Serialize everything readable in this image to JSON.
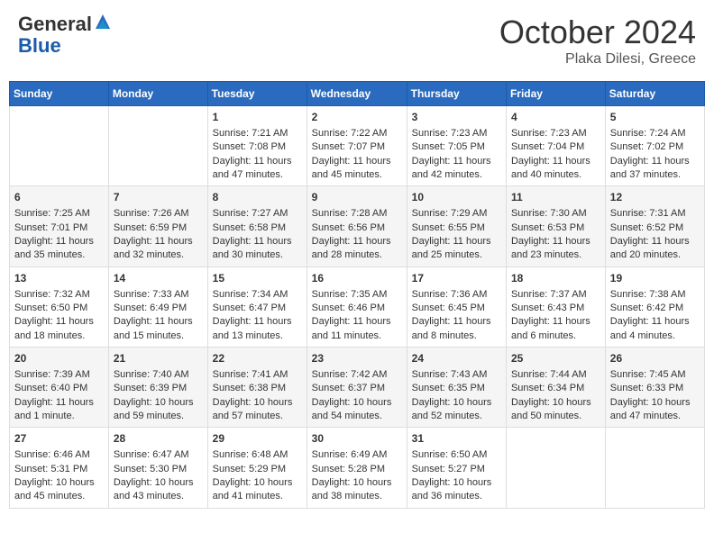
{
  "header": {
    "logo_general": "General",
    "logo_blue": "Blue",
    "title": "October 2024",
    "subtitle": "Plaka Dilesi, Greece"
  },
  "days_of_week": [
    "Sunday",
    "Monday",
    "Tuesday",
    "Wednesday",
    "Thursday",
    "Friday",
    "Saturday"
  ],
  "weeks": [
    [
      {
        "day": "",
        "content": ""
      },
      {
        "day": "",
        "content": ""
      },
      {
        "day": "1",
        "content": "Sunrise: 7:21 AM\nSunset: 7:08 PM\nDaylight: 11 hours and 47 minutes."
      },
      {
        "day": "2",
        "content": "Sunrise: 7:22 AM\nSunset: 7:07 PM\nDaylight: 11 hours and 45 minutes."
      },
      {
        "day": "3",
        "content": "Sunrise: 7:23 AM\nSunset: 7:05 PM\nDaylight: 11 hours and 42 minutes."
      },
      {
        "day": "4",
        "content": "Sunrise: 7:23 AM\nSunset: 7:04 PM\nDaylight: 11 hours and 40 minutes."
      },
      {
        "day": "5",
        "content": "Sunrise: 7:24 AM\nSunset: 7:02 PM\nDaylight: 11 hours and 37 minutes."
      }
    ],
    [
      {
        "day": "6",
        "content": "Sunrise: 7:25 AM\nSunset: 7:01 PM\nDaylight: 11 hours and 35 minutes."
      },
      {
        "day": "7",
        "content": "Sunrise: 7:26 AM\nSunset: 6:59 PM\nDaylight: 11 hours and 32 minutes."
      },
      {
        "day": "8",
        "content": "Sunrise: 7:27 AM\nSunset: 6:58 PM\nDaylight: 11 hours and 30 minutes."
      },
      {
        "day": "9",
        "content": "Sunrise: 7:28 AM\nSunset: 6:56 PM\nDaylight: 11 hours and 28 minutes."
      },
      {
        "day": "10",
        "content": "Sunrise: 7:29 AM\nSunset: 6:55 PM\nDaylight: 11 hours and 25 minutes."
      },
      {
        "day": "11",
        "content": "Sunrise: 7:30 AM\nSunset: 6:53 PM\nDaylight: 11 hours and 23 minutes."
      },
      {
        "day": "12",
        "content": "Sunrise: 7:31 AM\nSunset: 6:52 PM\nDaylight: 11 hours and 20 minutes."
      }
    ],
    [
      {
        "day": "13",
        "content": "Sunrise: 7:32 AM\nSunset: 6:50 PM\nDaylight: 11 hours and 18 minutes."
      },
      {
        "day": "14",
        "content": "Sunrise: 7:33 AM\nSunset: 6:49 PM\nDaylight: 11 hours and 15 minutes."
      },
      {
        "day": "15",
        "content": "Sunrise: 7:34 AM\nSunset: 6:47 PM\nDaylight: 11 hours and 13 minutes."
      },
      {
        "day": "16",
        "content": "Sunrise: 7:35 AM\nSunset: 6:46 PM\nDaylight: 11 hours and 11 minutes."
      },
      {
        "day": "17",
        "content": "Sunrise: 7:36 AM\nSunset: 6:45 PM\nDaylight: 11 hours and 8 minutes."
      },
      {
        "day": "18",
        "content": "Sunrise: 7:37 AM\nSunset: 6:43 PM\nDaylight: 11 hours and 6 minutes."
      },
      {
        "day": "19",
        "content": "Sunrise: 7:38 AM\nSunset: 6:42 PM\nDaylight: 11 hours and 4 minutes."
      }
    ],
    [
      {
        "day": "20",
        "content": "Sunrise: 7:39 AM\nSunset: 6:40 PM\nDaylight: 11 hours and 1 minute."
      },
      {
        "day": "21",
        "content": "Sunrise: 7:40 AM\nSunset: 6:39 PM\nDaylight: 10 hours and 59 minutes."
      },
      {
        "day": "22",
        "content": "Sunrise: 7:41 AM\nSunset: 6:38 PM\nDaylight: 10 hours and 57 minutes."
      },
      {
        "day": "23",
        "content": "Sunrise: 7:42 AM\nSunset: 6:37 PM\nDaylight: 10 hours and 54 minutes."
      },
      {
        "day": "24",
        "content": "Sunrise: 7:43 AM\nSunset: 6:35 PM\nDaylight: 10 hours and 52 minutes."
      },
      {
        "day": "25",
        "content": "Sunrise: 7:44 AM\nSunset: 6:34 PM\nDaylight: 10 hours and 50 minutes."
      },
      {
        "day": "26",
        "content": "Sunrise: 7:45 AM\nSunset: 6:33 PM\nDaylight: 10 hours and 47 minutes."
      }
    ],
    [
      {
        "day": "27",
        "content": "Sunrise: 6:46 AM\nSunset: 5:31 PM\nDaylight: 10 hours and 45 minutes."
      },
      {
        "day": "28",
        "content": "Sunrise: 6:47 AM\nSunset: 5:30 PM\nDaylight: 10 hours and 43 minutes."
      },
      {
        "day": "29",
        "content": "Sunrise: 6:48 AM\nSunset: 5:29 PM\nDaylight: 10 hours and 41 minutes."
      },
      {
        "day": "30",
        "content": "Sunrise: 6:49 AM\nSunset: 5:28 PM\nDaylight: 10 hours and 38 minutes."
      },
      {
        "day": "31",
        "content": "Sunrise: 6:50 AM\nSunset: 5:27 PM\nDaylight: 10 hours and 36 minutes."
      },
      {
        "day": "",
        "content": ""
      },
      {
        "day": "",
        "content": ""
      }
    ]
  ]
}
